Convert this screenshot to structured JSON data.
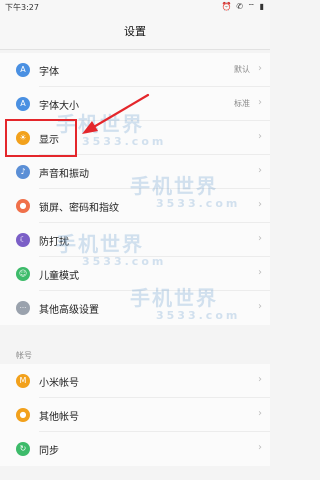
{
  "status_bar": {
    "time": "下午3:27",
    "icons": "⏰ ✆ ⌔ ▮"
  },
  "title": "设置",
  "groups": [
    {
      "items": [
        {
          "label": "字体",
          "value": "默认",
          "icon": "font-icon",
          "icon_glyph": "A",
          "color": "#4a90e2"
        },
        {
          "label": "字体大小",
          "value": "标准",
          "icon": "font-size-icon",
          "icon_glyph": "A",
          "color": "#4a90e2"
        },
        {
          "label": "显示",
          "value": "",
          "icon": "display-icon",
          "icon_glyph": "☀",
          "color": "#f2a11c"
        },
        {
          "label": "声音和振动",
          "value": "",
          "icon": "sound-icon",
          "icon_glyph": "♪",
          "color": "#5b8fd6"
        },
        {
          "label": "锁屏、密码和指纹",
          "value": "",
          "icon": "lock-icon",
          "icon_glyph": "●",
          "color": "#f0704a"
        },
        {
          "label": "防打扰",
          "value": "",
          "icon": "do-not-disturb-icon",
          "icon_glyph": "☾",
          "color": "#7b5fc7"
        },
        {
          "label": "儿童模式",
          "value": "",
          "icon": "kids-mode-icon",
          "icon_glyph": "☺",
          "color": "#3dbb6a"
        },
        {
          "label": "其他高级设置",
          "value": "",
          "icon": "more-settings-icon",
          "icon_glyph": "···",
          "color": "#9aa2ad"
        }
      ]
    },
    {
      "header": "帐号",
      "items": [
        {
          "label": "小米帐号",
          "value": "",
          "icon": "mi-account-icon",
          "icon_glyph": "M",
          "color": "#f2a11c"
        },
        {
          "label": "其他帐号",
          "value": "",
          "icon": "other-account-icon",
          "icon_glyph": "●",
          "color": "#f2a11c"
        },
        {
          "label": "同步",
          "value": "",
          "icon": "sync-icon",
          "icon_glyph": "↻",
          "color": "#3dbb6a"
        }
      ]
    }
  ],
  "chevron": "›",
  "annotation": {
    "highlight_color": "#e4262b"
  },
  "watermark": {
    "main": "手机世界",
    "sub": "3533.com"
  }
}
